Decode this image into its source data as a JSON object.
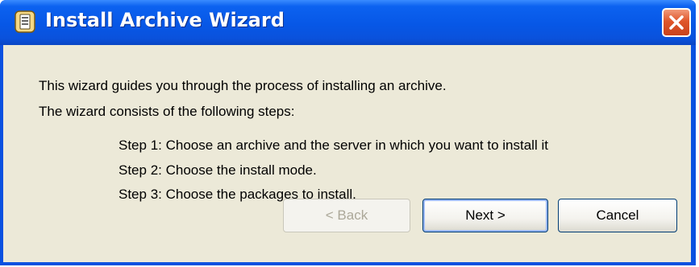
{
  "window": {
    "title": "Install Archive Wizard",
    "icon": "archive-wizard-icon",
    "close_icon": "close-icon"
  },
  "content": {
    "intro_line_1": "This wizard guides you through the process of installing an archive.",
    "intro_line_2": "The wizard consists of the following steps:",
    "steps": [
      "Step 1: Choose an archive and the server in which you want to install it",
      "Step 2: Choose the install mode.",
      "Step 3: Choose the packages to install."
    ]
  },
  "buttons": {
    "back_label": "< Back",
    "next_label": "Next >",
    "cancel_label": "Cancel"
  },
  "colors": {
    "titlebar": "#0757e6",
    "client_background": "#ece9d8",
    "close_button": "#e0562a",
    "disabled_text": "#aca899"
  }
}
